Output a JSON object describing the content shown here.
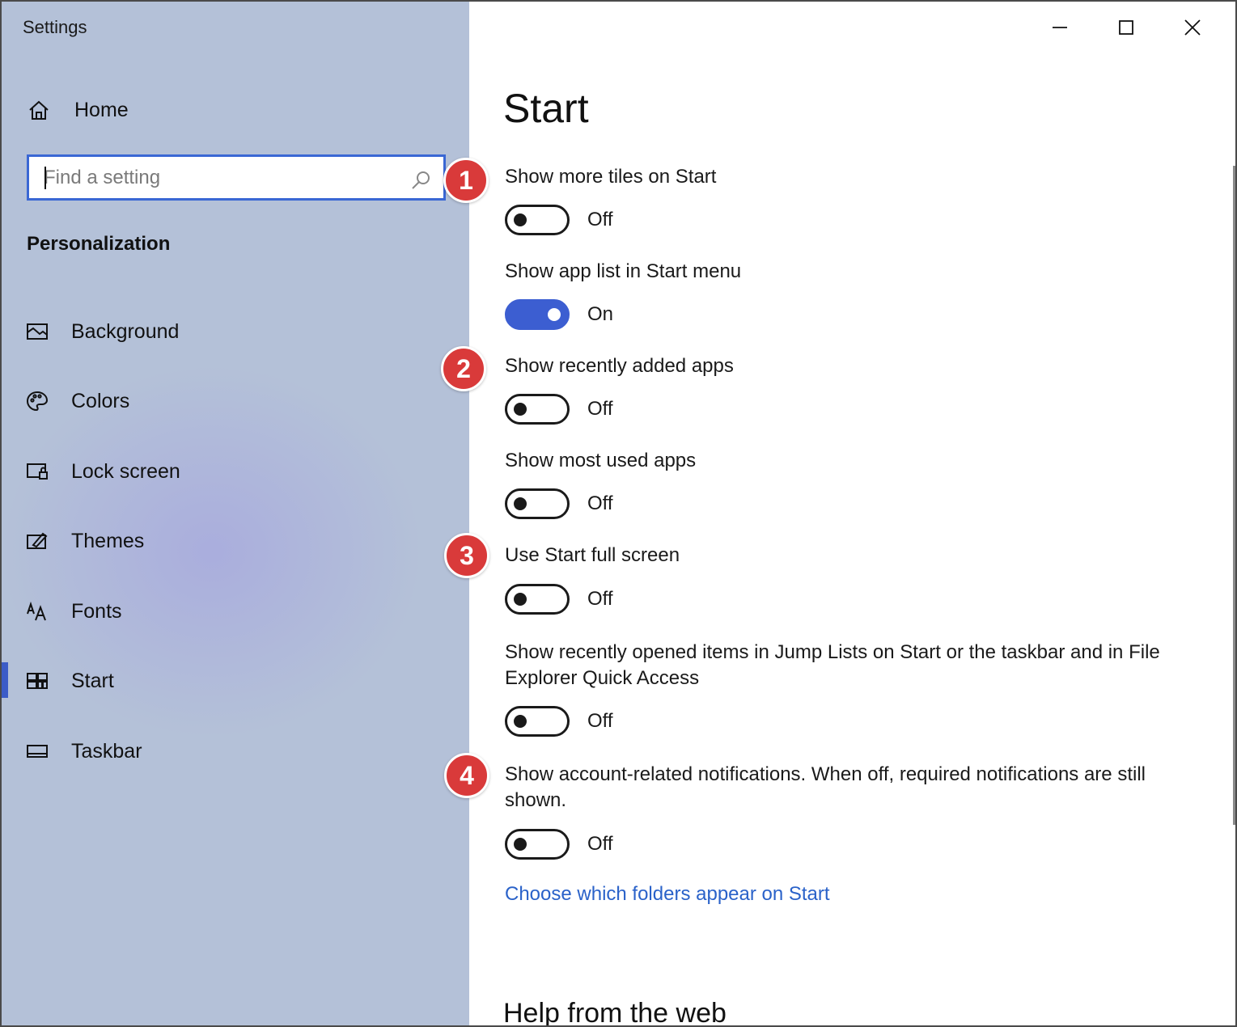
{
  "window": {
    "title": "Settings",
    "controls": {
      "minimize": "minimize-icon",
      "maximize": "maximize-icon",
      "close": "close-icon"
    }
  },
  "sidebar": {
    "home_label": "Home",
    "search": {
      "placeholder": "Find a setting",
      "value": ""
    },
    "section_title": "Personalization",
    "items": [
      {
        "label": "Background",
        "icon": "picture-icon"
      },
      {
        "label": "Colors",
        "icon": "palette-icon"
      },
      {
        "label": "Lock screen",
        "icon": "lock-screen-icon"
      },
      {
        "label": "Themes",
        "icon": "themes-icon"
      },
      {
        "label": "Fonts",
        "icon": "fonts-icon"
      },
      {
        "label": "Start",
        "icon": "start-icon",
        "selected": true
      },
      {
        "label": "Taskbar",
        "icon": "taskbar-icon"
      }
    ]
  },
  "main": {
    "title": "Start",
    "settings": [
      {
        "label": "Show more tiles on Start",
        "state": "Off"
      },
      {
        "label": "Show app list in Start menu",
        "state": "On"
      },
      {
        "label": "Show recently added apps",
        "state": "Off"
      },
      {
        "label": "Show most used apps",
        "state": "Off"
      },
      {
        "label": "Use Start full screen",
        "state": "Off"
      },
      {
        "label": "Show recently opened items in Jump Lists on Start or the taskbar and in File Explorer Quick Access",
        "state": "Off"
      },
      {
        "label": "Show account-related notifications. When off, required notifications are still shown.",
        "state": "Off"
      }
    ],
    "folders_link": "Choose which folders appear on Start",
    "help_title": "Help from the web"
  },
  "annotations": [
    "1",
    "2",
    "3",
    "4"
  ],
  "colors": {
    "accent": "#3c5ed1",
    "link": "#2a62c9",
    "badge": "#d93a3a",
    "sidebar_bg": "#b4c1d8"
  }
}
